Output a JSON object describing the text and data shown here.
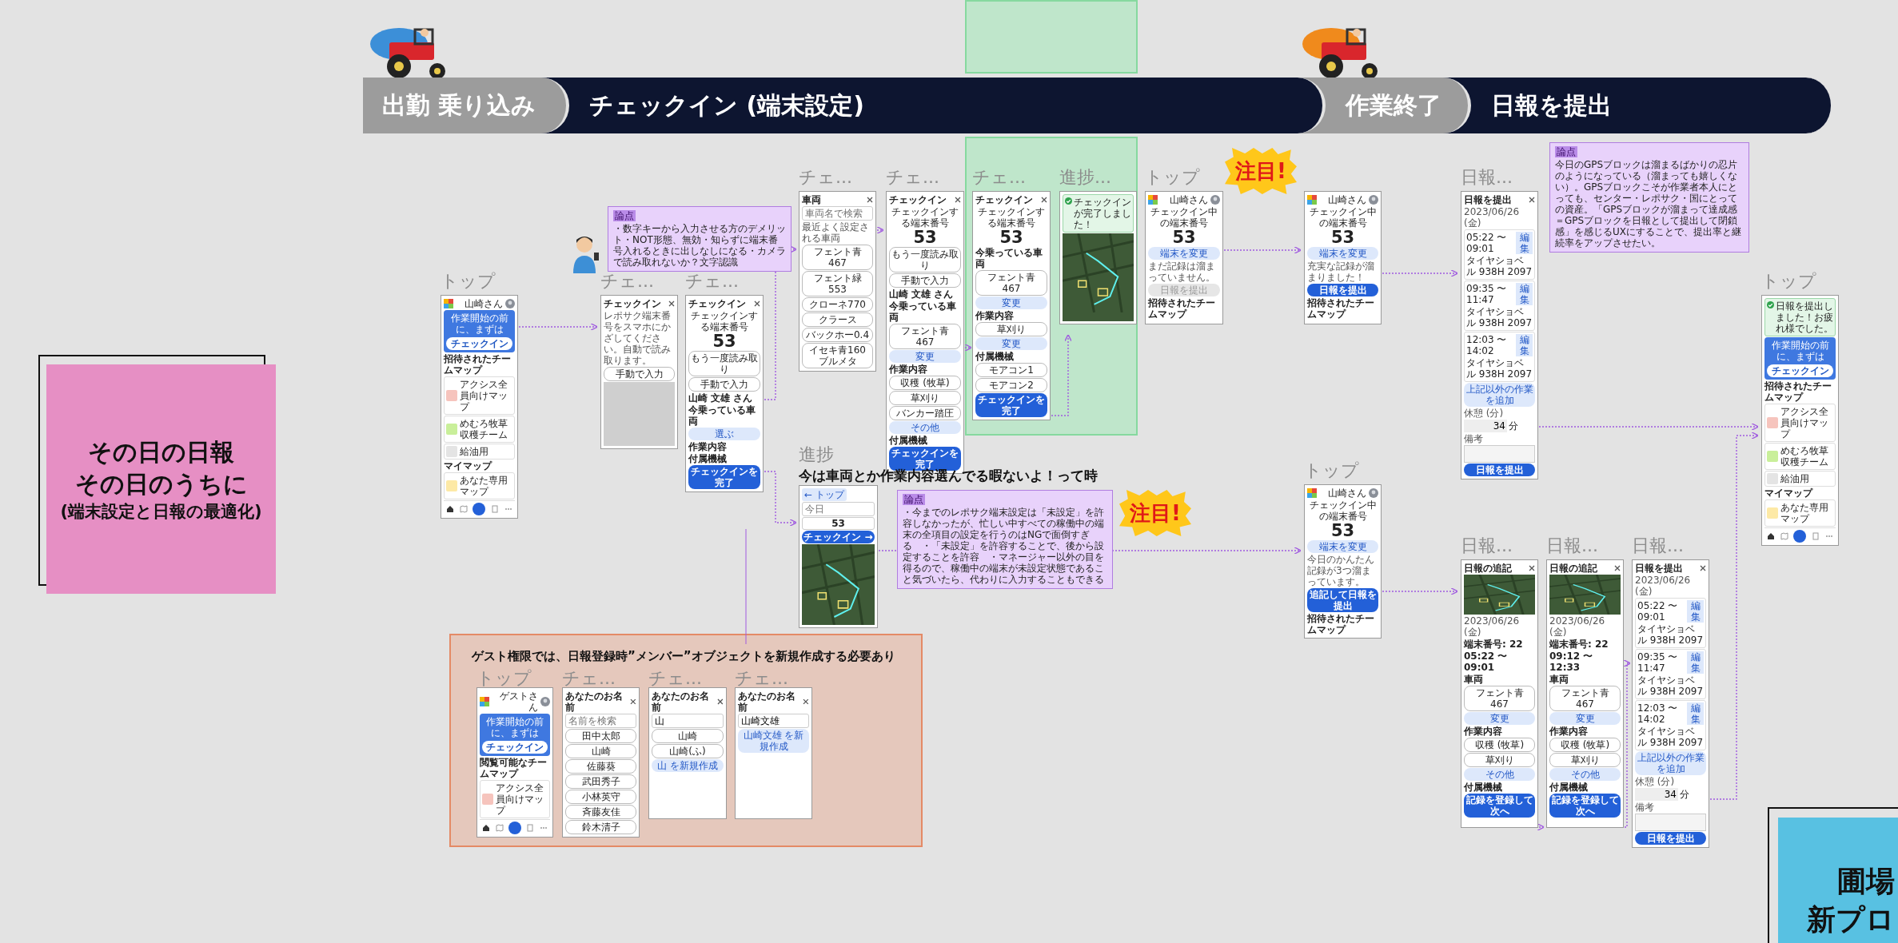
{
  "phase_bar": [
    {
      "label": "出勤 乗り込み",
      "kind": "minor"
    },
    {
      "label": "チェックイン (端末設定)",
      "kind": "major"
    },
    {
      "label": "作業終了",
      "kind": "minor"
    },
    {
      "label": "日報を提出",
      "kind": "major"
    }
  ],
  "sticky_notes": [
    {
      "lines": [
        "その日の日報",
        "その日のうちに",
        "(端末設定と日報の最適化)"
      ]
    },
    {
      "lines": [
        "圃場",
        "新プロ"
      ]
    }
  ],
  "notes": [
    {
      "tag": "論点",
      "body": "・数字キーから入力させる方のデメリット・NOT形態、無効・知らずに端末番号入れるときに出しなしになる・カメラで読み取れないか？文字認識"
    },
    {
      "tag": "論点",
      "body": "今日のGPSブロックは溜まるばかりの忍片のようになっている（溜まっても嬉しくない）。GPSブロックこそが作業者本人にとっても、センター・レポサク・国にとっての資産。「GPSブロックが溜まって達成感＝GPSブロックを日報として提出して閉鎖感」を感じるUXにすることで、提出率と継続率をアップさせたい。"
    },
    {
      "tag": "論点",
      "body": "・今までのレポサク端末設定は「未設定」を許容しなかったが、忙しい中すべての稼働中の端末の全項目の設定を行うのはNGで面倒すぎる　・「未設定」を許容することで、後から設定することを許容　・マネージャー以外の目を得るので、稼働中の端末が未設定状態であること気づいたら、代わりに入力することもできる"
    }
  ],
  "badges": [
    {
      "text": "注目!"
    },
    {
      "text": "注目!"
    }
  ],
  "caption": "今は車両とか作業内容選んでる暇ないよ！って時",
  "screens": [
    {
      "label": "トップ",
      "items": [
        {
          "kind": "user",
          "text": "山崎さん"
        },
        {
          "kind": "cta",
          "text": "作業開始の前に、まずは",
          "button": "チェックイン"
        },
        {
          "kind": "heading",
          "text": "招待されたチームマップ"
        },
        {
          "kind": "tile",
          "text": "アクシス全員向けマップ",
          "color": "#f6c4bd"
        },
        {
          "kind": "tile",
          "text": "めむろ牧草収穫チーム",
          "color": "#c9ef9a"
        },
        {
          "kind": "tile",
          "text": "給油用",
          "color": "#e4e4e4"
        },
        {
          "kind": "heading",
          "text": "マイマップ"
        },
        {
          "kind": "tile",
          "text": "あなた専用マップ",
          "color": "#fde9a6"
        },
        {
          "kind": "tabbar"
        }
      ]
    },
    {
      "label": "チェ...",
      "items": [
        {
          "kind": "bar",
          "text": "チェックイン"
        },
        {
          "kind": "note",
          "text": "レポサク端末番号をスマホにかざしてください。自動で読み取ります。"
        },
        {
          "kind": "pill",
          "text": "手動で入力"
        },
        {
          "kind": "photo"
        }
      ]
    },
    {
      "label": "チェ...",
      "items": [
        {
          "kind": "bar",
          "text": "チェックイン"
        },
        {
          "kind": "big",
          "caption": "チェックインする端末番号",
          "number": "53"
        },
        {
          "kind": "pill",
          "text": "もう一度読み取り"
        },
        {
          "kind": "pill",
          "text": "手動で入力"
        },
        {
          "kind": "label",
          "text": "山崎 文雄 さん"
        },
        {
          "kind": "heading",
          "text": "今乗っている車両"
        },
        {
          "kind": "action",
          "text": "選ぶ"
        },
        {
          "kind": "heading",
          "text": "作業内容"
        },
        {
          "kind": "heading",
          "text": "付属機械"
        },
        {
          "kind": "primary",
          "text": "チェックインを完了"
        }
      ]
    },
    {
      "label": "チェ...",
      "items": [
        {
          "kind": "bar",
          "text": "車両"
        },
        {
          "kind": "search",
          "placeholder": "車両名で検索"
        },
        {
          "kind": "note",
          "text": "最近よく設定される車両"
        },
        {
          "kind": "pill",
          "text": "フェント青 467"
        },
        {
          "kind": "pill",
          "text": "フェント緑 553"
        },
        {
          "kind": "pill",
          "text": "クローネ770"
        },
        {
          "kind": "pill",
          "text": "クラース"
        },
        {
          "kind": "pill",
          "text": "バックホー0.4"
        },
        {
          "kind": "pill",
          "text": "イセキ青160 ブルメタ"
        }
      ]
    },
    {
      "label": "チェ...",
      "items": [
        {
          "kind": "bar",
          "text": "チェックイン"
        },
        {
          "kind": "big",
          "caption": "チェックインする端末番号",
          "number": "53"
        },
        {
          "kind": "pill",
          "text": "もう一度読み取り"
        },
        {
          "kind": "pill",
          "text": "手動で入力"
        },
        {
          "kind": "label",
          "text": "山崎 文雄 さん"
        },
        {
          "kind": "heading",
          "text": "今乗っている車両"
        },
        {
          "kind": "pill",
          "text": "フェント青 467"
        },
        {
          "kind": "action",
          "text": "変更"
        },
        {
          "kind": "heading",
          "text": "作業内容"
        },
        {
          "kind": "pill",
          "text": "収穫 (牧草)"
        },
        {
          "kind": "pill",
          "text": "草刈り"
        },
        {
          "kind": "pill",
          "text": "バンカー踏圧"
        },
        {
          "kind": "action",
          "text": "その他"
        },
        {
          "kind": "heading",
          "text": "付属機械"
        },
        {
          "kind": "primary",
          "text": "チェックインを完了"
        }
      ]
    },
    {
      "label": "チェ...",
      "items": [
        {
          "kind": "bar",
          "text": "チェックイン"
        },
        {
          "kind": "big",
          "caption": "チェックインする端末番号",
          "number": "53"
        },
        {
          "kind": "heading",
          "text": "今乗っている車両"
        },
        {
          "kind": "pill",
          "text": "フェント青 467"
        },
        {
          "kind": "action",
          "text": "変更"
        },
        {
          "kind": "heading",
          "text": "作業内容"
        },
        {
          "kind": "pill",
          "text": "草刈り"
        },
        {
          "kind": "action",
          "text": "変更"
        },
        {
          "kind": "heading",
          "text": "付属機械"
        },
        {
          "kind": "pill",
          "text": "モアコン1"
        },
        {
          "kind": "pill",
          "text": "モアコン2"
        },
        {
          "kind": "primary",
          "text": "チェックインを完了"
        }
      ]
    },
    {
      "label": "進捗...",
      "items": [
        {
          "kind": "toast",
          "text": "チェックインが完了しました！"
        },
        {
          "kind": "map"
        }
      ]
    },
    {
      "label": "トップ",
      "items": [
        {
          "kind": "user",
          "text": "山崎さん"
        },
        {
          "kind": "big",
          "caption": "チェックイン中の端末番号",
          "number": "53"
        },
        {
          "kind": "action",
          "text": "端末を変更"
        },
        {
          "kind": "note",
          "text": "まだ記録は溜まっていません。"
        },
        {
          "kind": "disabled",
          "text": "日報を提出"
        },
        {
          "kind": "heading",
          "text": "招待されたチームマップ"
        }
      ]
    },
    {
      "items": [
        {
          "kind": "user",
          "text": "山崎さん"
        },
        {
          "kind": "big",
          "caption": "チェックイン中の端末番号",
          "number": "53"
        },
        {
          "kind": "action",
          "text": "端末を変更"
        },
        {
          "kind": "note",
          "text": "充実な記録が溜まりました！"
        },
        {
          "kind": "primary",
          "text": "日報を提出"
        },
        {
          "kind": "heading",
          "text": "招待されたチームマップ"
        }
      ]
    },
    {
      "label": "日報...",
      "items": [
        {
          "kind": "bar",
          "text": "日報を提出"
        },
        {
          "kind": "note",
          "text": "2023/06/26 (金)"
        },
        {
          "kind": "entry",
          "time": "05:22 〜 09:01",
          "button": "編集",
          "detail": "タイヤショベル 938H 2097"
        },
        {
          "kind": "entry",
          "time": "09:35 〜 11:47",
          "button": "編集",
          "detail": "タイヤショベル 938H 2097"
        },
        {
          "kind": "entry",
          "time": "12:03 〜 14:02",
          "button": "編集",
          "detail": "タイヤショベル 938H 2097"
        },
        {
          "kind": "action",
          "text": "上記以外の作業を追加"
        },
        {
          "kind": "note",
          "text": "休憩 (分)"
        },
        {
          "kind": "field",
          "value": "34",
          "unit": "分"
        },
        {
          "kind": "note",
          "text": "備考"
        },
        {
          "kind": "textarea"
        },
        {
          "kind": "primary",
          "text": "日報を提出"
        }
      ]
    },
    {
      "label": "トップ",
      "items": [
        {
          "kind": "toast",
          "text": "日報を提出しました！お疲れ様でした。"
        },
        {
          "kind": "cta",
          "text": "作業開始の前に、まずは",
          "button": "チェックイン"
        },
        {
          "kind": "heading",
          "text": "招待されたチームマップ"
        },
        {
          "kind": "tile",
          "text": "アクシス全員向けマップ",
          "color": "#f6c4bd"
        },
        {
          "kind": "tile",
          "text": "めむろ牧草収穫チーム",
          "color": "#c9ef9a"
        },
        {
          "kind": "tile",
          "text": "給油用",
          "color": "#e4e4e4"
        },
        {
          "kind": "heading",
          "text": "マイマップ"
        },
        {
          "kind": "tile",
          "text": "あなた専用マップ",
          "color": "#fde9a6"
        },
        {
          "kind": "tabbar"
        }
      ]
    },
    {
      "label": "進捗",
      "items": [
        {
          "kind": "back",
          "text": "← トップ"
        },
        {
          "kind": "search",
          "placeholder": "今日"
        },
        {
          "kind": "card",
          "text": "53"
        },
        {
          "kind": "primary",
          "text": "チェックイン →"
        },
        {
          "kind": "map"
        }
      ]
    },
    {
      "label": "トップ",
      "items": [
        {
          "kind": "user",
          "text": "山崎さん"
        },
        {
          "kind": "big",
          "caption": "チェックイン中の端末番号",
          "number": "53"
        },
        {
          "kind": "action",
          "text": "端末を変更"
        },
        {
          "kind": "note",
          "text": "今日のかんたん記録が3つ溜まっています。"
        },
        {
          "kind": "primary",
          "text": "追記して日報を提出"
        },
        {
          "kind": "heading",
          "text": "招待されたチームマップ"
        }
      ]
    },
    {
      "label": "日報...",
      "items": [
        {
          "kind": "bar",
          "text": "日報の追記"
        },
        {
          "kind": "mapsmall"
        },
        {
          "kind": "note",
          "text": "2023/06/26 (金)"
        },
        {
          "kind": "label",
          "text": "端末番号: 22"
        },
        {
          "kind": "label",
          "text": "05:22 〜 09:01"
        },
        {
          "kind": "heading",
          "text": "車両"
        },
        {
          "kind": "pill",
          "text": "フェント青 467"
        },
        {
          "kind": "action",
          "text": "変更"
        },
        {
          "kind": "heading",
          "text": "作業内容"
        },
        {
          "kind": "pill",
          "text": "収穫 (牧草)"
        },
        {
          "kind": "pill",
          "text": "草刈り"
        },
        {
          "kind": "action",
          "text": "その他"
        },
        {
          "kind": "heading",
          "text": "付属機械"
        },
        {
          "kind": "primary",
          "text": "記録を登録して次へ"
        }
      ]
    },
    {
      "label": "日報...",
      "items": [
        {
          "kind": "bar",
          "text": "日報の追記"
        },
        {
          "kind": "mapsmall"
        },
        {
          "kind": "note",
          "text": "2023/06/26 (金)"
        },
        {
          "kind": "label",
          "text": "端末番号: 22"
        },
        {
          "kind": "label",
          "text": "09:12 〜 12:33"
        },
        {
          "kind": "heading",
          "text": "車両"
        },
        {
          "kind": "pill",
          "text": "フェント青 467"
        },
        {
          "kind": "action",
          "text": "変更"
        },
        {
          "kind": "heading",
          "text": "作業内容"
        },
        {
          "kind": "pill",
          "text": "収穫 (牧草)"
        },
        {
          "kind": "pill",
          "text": "草刈り"
        },
        {
          "kind": "action",
          "text": "その他"
        },
        {
          "kind": "heading",
          "text": "付属機械"
        },
        {
          "kind": "primary",
          "text": "記録を登録して次へ"
        }
      ]
    },
    {
      "label": "日報...",
      "items": [
        {
          "kind": "bar",
          "text": "日報を提出"
        },
        {
          "kind": "note",
          "text": "2023/06/26 (金)"
        },
        {
          "kind": "entry",
          "time": "05:22 〜 09:01",
          "button": "編集",
          "detail": "タイヤショベル 938H 2097"
        },
        {
          "kind": "entry",
          "time": "09:35 〜 11:47",
          "button": "編集",
          "detail": "タイヤショベル 938H 2097"
        },
        {
          "kind": "entry",
          "time": "12:03 〜 14:02",
          "button": "編集",
          "detail": "タイヤショベル 938H 2097"
        },
        {
          "kind": "action",
          "text": "上記以外の作業を追加"
        },
        {
          "kind": "note",
          "text": "休憩 (分)"
        },
        {
          "kind": "field",
          "value": "34",
          "unit": "分"
        },
        {
          "kind": "note",
          "text": "備考"
        },
        {
          "kind": "textarea"
        },
        {
          "kind": "primary",
          "text": "日報を提出"
        }
      ]
    }
  ],
  "guest_section": {
    "title": "ゲスト権限では、日報登録時”メンバー”オブジェクトを新規作成する必要あり",
    "screens": [
      {
        "label": "トップ",
        "items": [
          {
            "kind": "user",
            "text": "ゲストさん"
          },
          {
            "kind": "cta",
            "text": "作業開始の前に、まずは",
            "button": "チェックイン"
          },
          {
            "kind": "heading",
            "text": "閲覧可能なチームマップ"
          },
          {
            "kind": "tile",
            "text": "アクシス全員向けマップ",
            "color": "#f6c4bd"
          },
          {
            "kind": "tabbar"
          }
        ]
      },
      {
        "label": "チェ...",
        "items": [
          {
            "kind": "bar",
            "text": "あなたのお名前"
          },
          {
            "kind": "search",
            "placeholder": "名前を検索"
          },
          {
            "kind": "pill",
            "text": "田中太郎"
          },
          {
            "kind": "pill",
            "text": "山崎"
          },
          {
            "kind": "pill",
            "text": "佐藤葵"
          },
          {
            "kind": "pill",
            "text": "武田秀子"
          },
          {
            "kind": "pill",
            "text": "小林英守"
          },
          {
            "kind": "pill",
            "text": "斉藤友佳"
          },
          {
            "kind": "pill",
            "text": "鈴木清子"
          }
        ]
      },
      {
        "label": "チェ...",
        "items": [
          {
            "kind": "bar",
            "text": "あなたのお名前"
          },
          {
            "kind": "search",
            "value": "山"
          },
          {
            "kind": "pill",
            "text": "山崎"
          },
          {
            "kind": "pill",
            "text": "山崎(ふ)"
          },
          {
            "kind": "action",
            "text": "山 を新規作成"
          }
        ]
      },
      {
        "label": "チェ...",
        "items": [
          {
            "kind": "bar",
            "text": "あなたのお名前"
          },
          {
            "kind": "search",
            "value": "山崎文雄"
          },
          {
            "kind": "action",
            "text": "山崎文雄 を新規作成"
          }
        ]
      }
    ]
  }
}
